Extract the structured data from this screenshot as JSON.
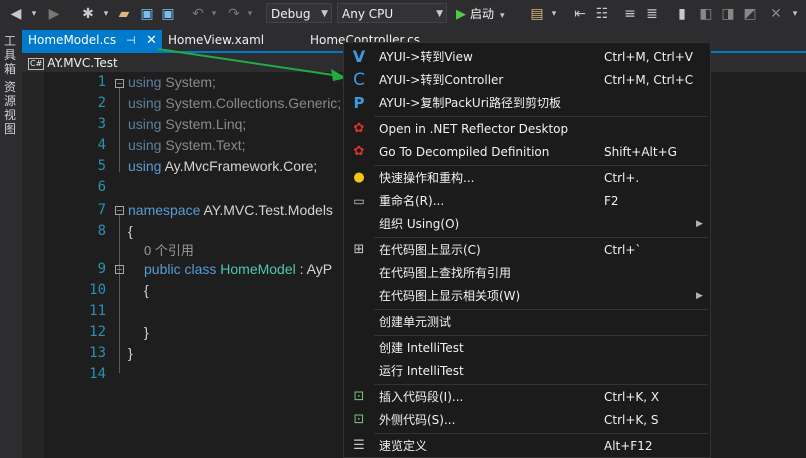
{
  "toolbar": {
    "config": "Debug",
    "platform": "Any CPU",
    "start_label": "启动"
  },
  "side_panels": [
    "工具箱",
    "资源视图"
  ],
  "tabs": [
    {
      "label": "HomeModel.cs"
    },
    {
      "label": "HomeView.xaml"
    },
    {
      "label": "HomeController.cs"
    }
  ],
  "nav": {
    "project": "AY.MVC.Test"
  },
  "code": {
    "line_numbers": [
      "1",
      "2",
      "3",
      "4",
      "5",
      "6",
      "7",
      "8",
      "9",
      "10",
      "11",
      "12",
      "13",
      "14"
    ],
    "line1_kw": "using",
    "line1_ns": " System;",
    "line2_kw": "using",
    "line2_ns": " System.Collections.Generic;",
    "line3_kw": "using",
    "line3_ns": " System.Linq;",
    "line4_kw": "using",
    "line4_ns": " System.Text;",
    "line5_kw": "using",
    "line5_ns": " Ay.MvcFramework.Core;",
    "line7_kw": "namespace",
    "line7_ns": " AY.MVC.Test.Models",
    "brace_open": "{",
    "brace_close": "}",
    "refs_hint": "0 个引用",
    "line9_kw": "public class",
    "line9_cls": " HomeModel",
    "line9_rest": " : AyP"
  },
  "menu": {
    "items": [
      {
        "label": "AYUI->转到View",
        "shortcut": "Ctrl+M, Ctrl+V",
        "icon": "V"
      },
      {
        "label": "AYUI->转到Controller",
        "shortcut": "Ctrl+M, Ctrl+C",
        "icon": "C"
      },
      {
        "label": "AYUI->复制PackUri路径到剪切板",
        "shortcut": "",
        "icon": "P"
      },
      {
        "label": "Open in .NET Reflector Desktop",
        "shortcut": ""
      },
      {
        "label": "Go To Decompiled Definition",
        "shortcut": "Shift+Alt+G"
      },
      {
        "label": "快速操作和重构...",
        "shortcut": "Ctrl+."
      },
      {
        "label": "重命名(R)...",
        "shortcut": "F2"
      },
      {
        "label": "组织 Using(O)",
        "shortcut": ""
      },
      {
        "label": "在代码图上显示(C)",
        "shortcut": "Ctrl+`"
      },
      {
        "label": "在代码图上查找所有引用",
        "shortcut": ""
      },
      {
        "label": "在代码图上显示相关项(W)",
        "shortcut": ""
      },
      {
        "label": "创建单元测试",
        "shortcut": ""
      },
      {
        "label": "创建 IntelliTest",
        "shortcut": ""
      },
      {
        "label": "运行 IntelliTest",
        "shortcut": ""
      },
      {
        "label": "插入代码段(I)...",
        "shortcut": "Ctrl+K, X"
      },
      {
        "label": "外侧代码(S)...",
        "shortcut": "Ctrl+K, S"
      },
      {
        "label": "速览定义",
        "shortcut": "Alt+F12"
      }
    ]
  },
  "colors": {
    "accent": "#007acc",
    "menu_bg": "#1b1b1c",
    "ayui_blue": "#3c9be0",
    "arrow_green": "#22aa44",
    "reflector_red": "#d9342b"
  }
}
